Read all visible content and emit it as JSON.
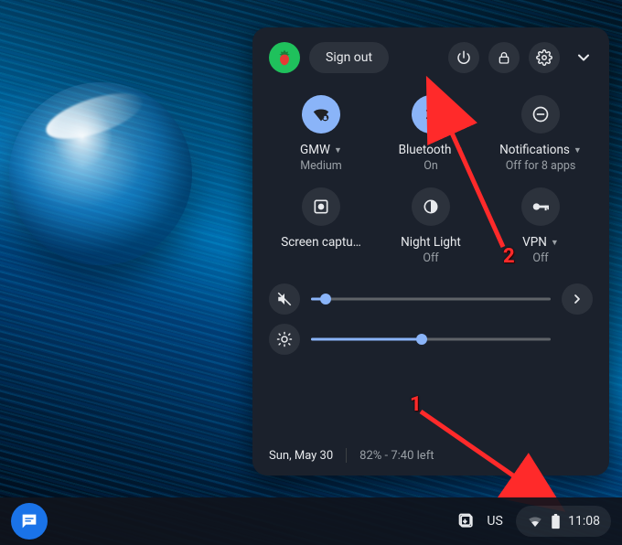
{
  "top_row": {
    "sign_out_label": "Sign out"
  },
  "tiles": {
    "wifi": {
      "label": "GMW",
      "sub": "Medium",
      "has_caret": true,
      "on": true
    },
    "bt": {
      "label": "Bluetooth",
      "sub": "On",
      "has_caret": true,
      "on": true
    },
    "notif": {
      "label": "Notifications",
      "sub": "Off for 8 apps",
      "has_caret": true,
      "on": false
    },
    "cap": {
      "label": "Screen captu…",
      "sub": "",
      "has_caret": false,
      "on": false
    },
    "night": {
      "label": "Night Light",
      "sub": "Off",
      "has_caret": false,
      "on": false
    },
    "vpn": {
      "label": "VPN",
      "sub": "Off",
      "has_caret": true,
      "on": false
    }
  },
  "sliders": {
    "volume_pct": 6,
    "brightness_pct": 46
  },
  "footer": {
    "date": "Sun, May 30",
    "battery_status": "82% - 7:40 left"
  },
  "shelf": {
    "ime": "US",
    "clock": "11:08"
  },
  "callouts": {
    "one": "1",
    "two": "2"
  }
}
